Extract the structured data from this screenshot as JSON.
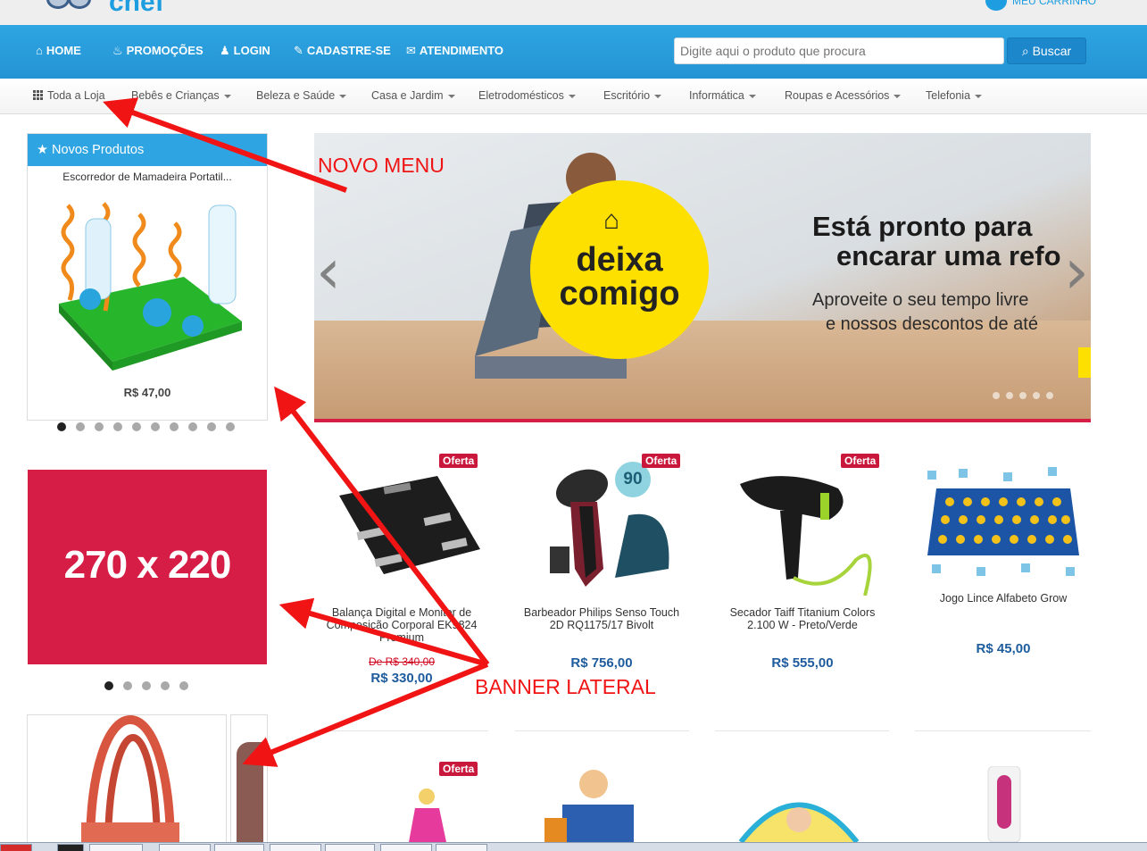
{
  "header": {
    "logo_text": "chef",
    "cart_text": "MEU CARRINHO"
  },
  "nav": {
    "items": [
      {
        "label": "HOME",
        "icon": "home-icon"
      },
      {
        "label": "PROMOÇÕES",
        "icon": "fire-icon"
      },
      {
        "label": "LOGIN",
        "icon": "user-icon"
      },
      {
        "label": "CADASTRE-SE",
        "icon": "edit-icon"
      },
      {
        "label": "ATENDIMENTO",
        "icon": "envelope-icon"
      }
    ],
    "search_placeholder": "Digite aqui o produto que procura",
    "search_button": "Buscar"
  },
  "categories": [
    "Toda a Loja",
    "Bebês e Crianças",
    "Beleza e Saúde",
    "Casa e Jardim",
    "Eletrodomésticos",
    "Escritório",
    "Informática",
    "Roupas e Acessórios",
    "Telefonia"
  ],
  "sidebar": {
    "new_products_title": "Novos Produtos",
    "product_title": "Escorredor de Mamadeira Portatil...",
    "product_price": "R$ 47,00",
    "banner_text": "270 x 220"
  },
  "hero": {
    "badge_line1": "deixa",
    "badge_line2": "comigo",
    "headline_line1": "Está pronto para",
    "headline_line2": "encarar uma refo",
    "sub_line1": "Aproveite o seu tempo livre",
    "sub_line2": "e nossos descontos de até",
    "prev_icon": "chevron-left-icon",
    "next_icon": "chevron-right-icon"
  },
  "products": [
    {
      "name_line1": "Balança Digital e Monitor de",
      "name_line2": "Composição Corporal EK9824",
      "name_line3": "Premium",
      "old_price": "De R$ 340,00",
      "price": "R$ 330,00",
      "badge": "Oferta"
    },
    {
      "name_line1": "Barbeador Philips Senso Touch",
      "name_line2": "2D RQ1175/17 Bivolt",
      "price": "R$ 756,00",
      "badge": "Oferta",
      "seal": "90"
    },
    {
      "name_line1": "Secador Taiff Titanium Colors",
      "name_line2": "2.100 W - Preto/Verde",
      "price": "R$ 555,00",
      "badge": "Oferta"
    },
    {
      "name_line1": "Jogo Lince Alfabeto Grow",
      "price": "R$ 45,00"
    }
  ],
  "second_row_badge": "Oferta",
  "annotations": {
    "menu_label": "NOVO MENU",
    "banner_label": "BANNER LATERAL"
  },
  "colors": {
    "nav_blue": "#2ea5e2",
    "banner_red": "#d51d46",
    "price_blue": "#1e5c9e",
    "annotation_red": "#f01414"
  }
}
